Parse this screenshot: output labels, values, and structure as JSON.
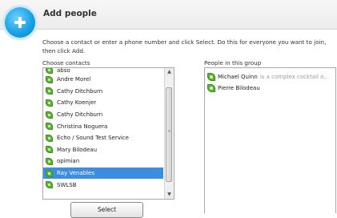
{
  "header": {
    "title": "Add people",
    "icon": "add-people-icon"
  },
  "instructions": "Choose a contact or enter a phone number and click Select. Do this for everyone you want to join, then click Add.",
  "contacts": {
    "label": "Choose contacts",
    "items": [
      {
        "name": "abso",
        "selected": false
      },
      {
        "name": "Andre Morel",
        "selected": false
      },
      {
        "name": "Cathy Ditchburn",
        "selected": false
      },
      {
        "name": "Cathy Koenjer",
        "selected": false
      },
      {
        "name": "Cathy Ditchburn",
        "selected": false
      },
      {
        "name": "Christina Noguera",
        "selected": false
      },
      {
        "name": "Echo / Sound Test Service",
        "selected": false
      },
      {
        "name": "Mary Bilodeau",
        "selected": false
      },
      {
        "name": "opimian",
        "selected": false
      },
      {
        "name": "Ray Venables",
        "selected": true
      },
      {
        "name": "SWLSB",
        "selected": false
      }
    ],
    "select_label": "Select"
  },
  "group": {
    "label": "People in this group",
    "members": [
      {
        "name": "Michael Quinn",
        "status": "is a complex cocktail o..."
      },
      {
        "name": "Pierre Bilodeau",
        "status": ""
      }
    ]
  },
  "colors": {
    "selection": "#3b8ee0",
    "online_status": "#5cb531",
    "accent": "#1aa3e6"
  }
}
